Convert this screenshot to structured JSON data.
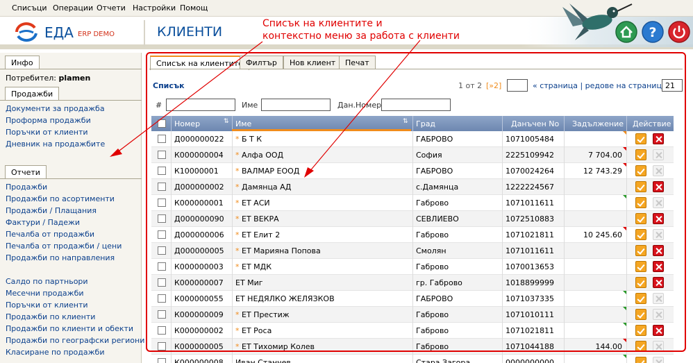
{
  "menubar": {
    "items": [
      "Списъци",
      "Операции",
      "Отчети",
      "Настройки",
      "Помощ"
    ]
  },
  "header": {
    "brand": "ЕДА",
    "brand_sub": "ERP DEMO",
    "title": "КЛИЕНТИ"
  },
  "annotation": {
    "line1": "Списък на клиентите и",
    "line2": "контекстно меню за работа с клиенти"
  },
  "sidebar": {
    "info_tab": "Инфо",
    "user_label": "Потребител:",
    "user_name": "plamen",
    "sales_tab": "Продажби",
    "sales_links": [
      "Документи за продажба",
      "Проформа продажби",
      "Поръчки от клиенти",
      "Дневник на продажбите"
    ],
    "reports_tab": "Отчети",
    "reports_links": [
      "Продажби",
      "Продажби по асортименти",
      "Продажби / Плащания",
      "Фактури / Падежи",
      "Печалба от продажби",
      "Печалба от продажби / цени",
      "Продажби по направления"
    ],
    "reports_links2": [
      "Салдо по партньори",
      "Месечни продажби",
      "Поръчки от клиенти",
      "Продажби по клиенти",
      "Продажби по клиенти и обекти",
      "Продажби по географски региони",
      "Класиране по продажби"
    ]
  },
  "tabs": [
    "Списък на клиентите",
    "Филтър",
    "Нов клиент",
    "Печат"
  ],
  "list": {
    "title": "Списък",
    "page_info": "1 от 2",
    "next": "[»2]",
    "page_label": "« страница | редове на страница »",
    "rows_per_page": "21"
  },
  "filters": {
    "num_label": "#",
    "name_label": "Име",
    "tax_label": "Дан.Номер"
  },
  "columns": [
    "Номер",
    "Име",
    "Град",
    "Данъчен No",
    "Задължение",
    "Действие"
  ],
  "rows": [
    {
      "num": "Д000000022",
      "star": true,
      "name": "Б Т К",
      "city": "ГАБРОВО",
      "tax": "1071005484",
      "debt": "",
      "mark": "o",
      "del": true
    },
    {
      "num": "К000000004",
      "star": true,
      "name": "Алфа ООД",
      "city": "София",
      "tax": "2225109942",
      "debt": "7 704.00",
      "mark": "r",
      "del": false
    },
    {
      "num": "К10000001",
      "star": true,
      "name": "ВАЛМАР ЕООД",
      "city": "ГАБРОВО",
      "tax": "1070024264",
      "debt": "12 743.29",
      "mark": "r",
      "del": false
    },
    {
      "num": "Д000000002",
      "star": true,
      "name": "Дамянца АД",
      "city": "с.Дамянца",
      "tax": "1222224567",
      "debt": "",
      "mark": "",
      "del": true
    },
    {
      "num": "К000000001",
      "star": true,
      "name": "ЕТ АСИ",
      "city": "Габрово",
      "tax": "1071011611",
      "debt": "",
      "mark": "g",
      "del": false
    },
    {
      "num": "Д000000090",
      "star": true,
      "name": "ЕТ ВЕКРА",
      "city": "СЕВЛИЕВО",
      "tax": "1072510883",
      "debt": "",
      "mark": "",
      "del": true
    },
    {
      "num": "Д000000006",
      "star": true,
      "name": "ЕТ Елит 2",
      "city": "Габрово",
      "tax": "1071021811",
      "debt": "10 245.60",
      "mark": "r",
      "del": false
    },
    {
      "num": "Д000000005",
      "star": true,
      "name": "ЕТ Марияна Попова",
      "city": "Смолян",
      "tax": "1071011611",
      "debt": "",
      "mark": "",
      "del": true
    },
    {
      "num": "К000000003",
      "star": true,
      "name": "ЕТ МДК",
      "city": "Габрово",
      "tax": "1070013653",
      "debt": "",
      "mark": "",
      "del": true
    },
    {
      "num": "К000000007",
      "star": false,
      "name": "ЕТ Миг",
      "city": "гр. Габрово",
      "tax": "1018899999",
      "debt": "",
      "mark": "",
      "del": true
    },
    {
      "num": "К000000055",
      "star": false,
      "name": "ЕТ НЕДЯЛКО ЖЕЛЯЗКОВ",
      "city": "ГАБРОВО",
      "tax": "1071037335",
      "debt": "",
      "mark": "g",
      "del": false
    },
    {
      "num": "К000000009",
      "star": true,
      "name": "ЕТ Престиж",
      "city": "Габрово",
      "tax": "1071010111",
      "debt": "",
      "mark": "g",
      "del": false
    },
    {
      "num": "К000000002",
      "star": true,
      "name": "ЕТ Роса",
      "city": "Габрово",
      "tax": "1071021811",
      "debt": "",
      "mark": "g",
      "del": true
    },
    {
      "num": "К000000005",
      "star": true,
      "name": "ЕТ Тихомир Колев",
      "city": "Габрово",
      "tax": "1071044188",
      "debt": "144.00",
      "mark": "r",
      "del": false
    },
    {
      "num": "К000000008",
      "star": false,
      "name": "Иван Станчев",
      "city": "Стара Загора",
      "tax": "0000000000",
      "debt": "",
      "mark": "g",
      "del": false
    }
  ]
}
